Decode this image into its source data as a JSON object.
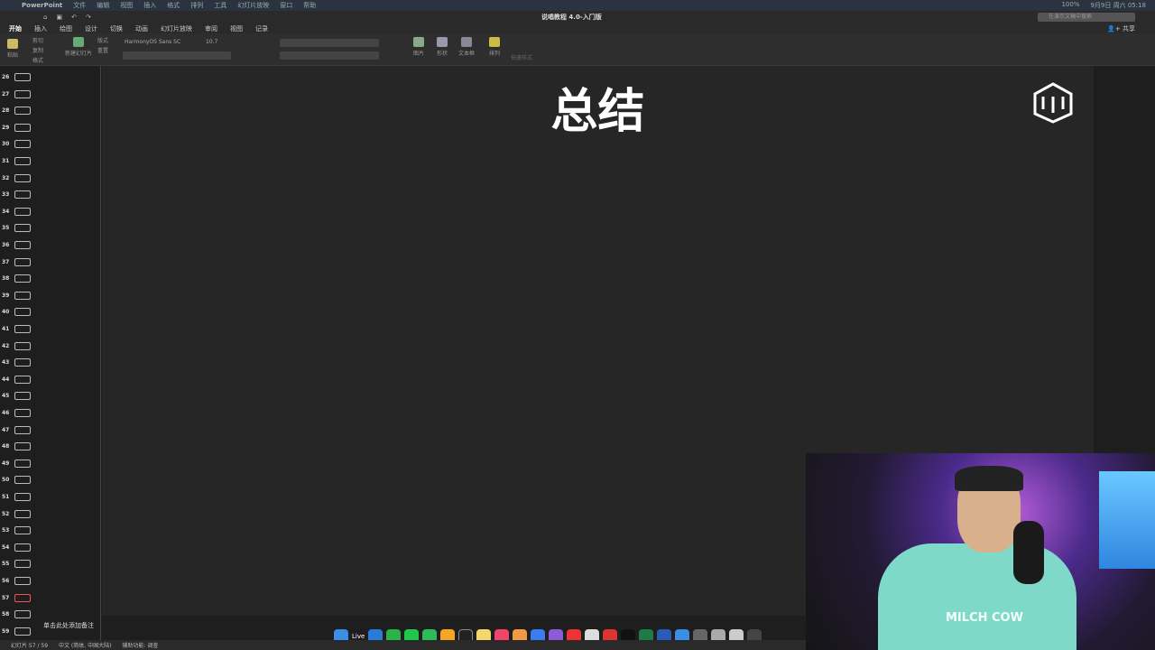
{
  "menubar": {
    "app": "PowerPoint",
    "items": [
      "文件",
      "编辑",
      "视图",
      "插入",
      "格式",
      "排列",
      "工具",
      "幻灯片放映",
      "窗口",
      "帮助"
    ],
    "date": "9月9日 周六 05:18",
    "battery": "100%"
  },
  "window": {
    "title": "说唱教程 4.0-入门版",
    "search_placeholder": "在演示文稿中搜索",
    "share": "共享"
  },
  "tabs": [
    "开始",
    "插入",
    "绘图",
    "设计",
    "切换",
    "动画",
    "幻灯片放映",
    "审阅",
    "视图",
    "记录"
  ],
  "ribbon": {
    "paste": "粘贴",
    "cut": "剪切",
    "copy": "复制",
    "format": "格式",
    "new_slide": "新建幻灯片",
    "layout": "版式",
    "reset": "重置",
    "font": "HarmonyOS Sans SC",
    "size": "10.7",
    "picture": "图片",
    "shapes": "形状",
    "textbox": "文本框",
    "arrange": "排列",
    "quick_styles": "快速样式"
  },
  "slides": {
    "numbers": [
      "26",
      "27",
      "28",
      "29",
      "30",
      "31",
      "32",
      "33",
      "34",
      "35",
      "36",
      "37",
      "38",
      "39",
      "40",
      "41",
      "42",
      "43",
      "44",
      "45",
      "46",
      "47",
      "48",
      "49",
      "50",
      "51",
      "52",
      "53",
      "54",
      "55",
      "56",
      "57",
      "58",
      "59"
    ],
    "selected": "57"
  },
  "slide": {
    "title": "总结",
    "logo": "DYE"
  },
  "notes_placeholder": "单击此处添加备注",
  "status": {
    "slide": "幻灯片 57 / 59",
    "language": "中文 (简体, 中国大陆)",
    "accessibility": "辅助功能: 调查"
  },
  "dock": {
    "live": "Live"
  },
  "webcam": {
    "shirt": "MILCH COW"
  }
}
